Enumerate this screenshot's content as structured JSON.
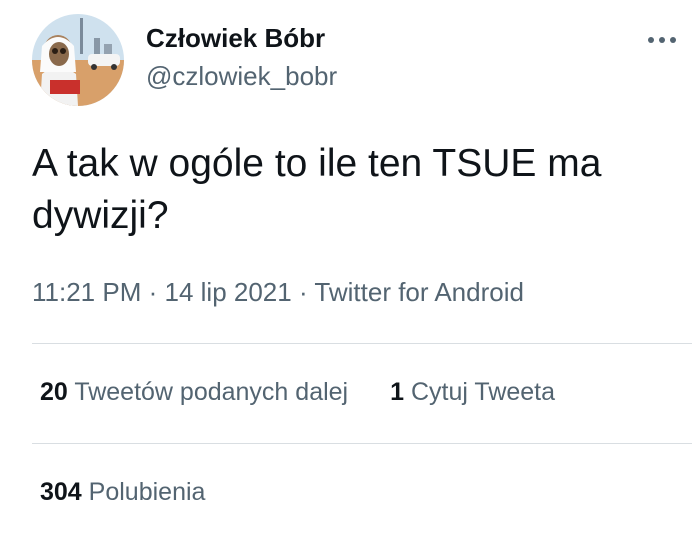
{
  "author": {
    "display_name": "Człowiek Bóbr",
    "handle": "@czlowiek_bobr"
  },
  "tweet": {
    "text": "A tak w ogóle to ile ten TSUE ma dywizji?",
    "time": "11:21 PM",
    "separator": "·",
    "date": "14 lip 2021",
    "source": "Twitter for Android"
  },
  "stats": {
    "retweets_count": "20",
    "retweets_label": "Tweetów podanych dalej",
    "quotes_count": "1",
    "quotes_label": "Cytuj Tweeta",
    "likes_count": "304",
    "likes_label": "Polubienia"
  },
  "icons": {
    "more": "more-horizontal-icon"
  },
  "colors": {
    "text_primary": "#0f1419",
    "text_secondary": "#536471",
    "divider": "#d9dee2"
  }
}
